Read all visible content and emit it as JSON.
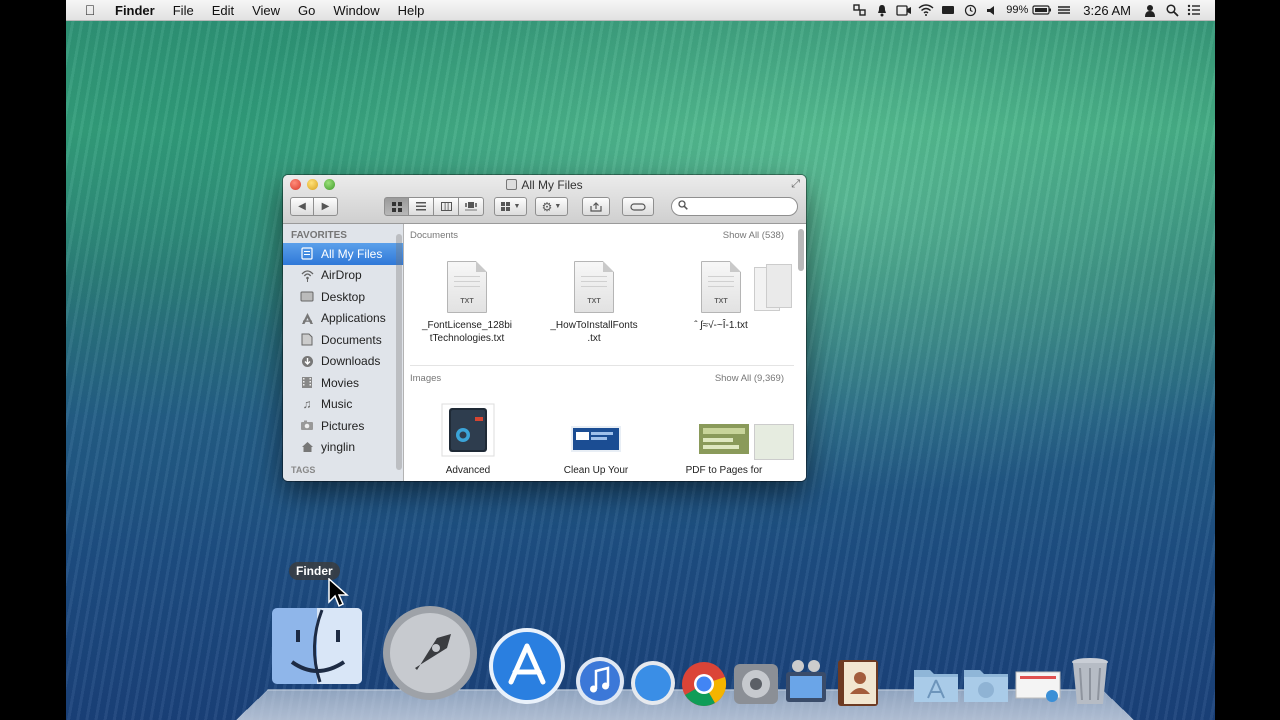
{
  "menubar": {
    "app_name": "Finder",
    "menus": [
      "File",
      "Edit",
      "View",
      "Go",
      "Window",
      "Help"
    ],
    "battery": "99%",
    "clock": "3:26 AM"
  },
  "window": {
    "title": "All My Files",
    "sidebar": {
      "favorites_header": "FAVORITES",
      "items": [
        {
          "label": "All My Files",
          "icon": "all-files-icon",
          "selected": true
        },
        {
          "label": "AirDrop",
          "icon": "airdrop-icon"
        },
        {
          "label": "Desktop",
          "icon": "desktop-icon"
        },
        {
          "label": "Applications",
          "icon": "applications-icon"
        },
        {
          "label": "Documents",
          "icon": "documents-icon"
        },
        {
          "label": "Downloads",
          "icon": "downloads-icon"
        },
        {
          "label": "Movies",
          "icon": "movies-icon"
        },
        {
          "label": "Music",
          "icon": "music-icon"
        },
        {
          "label": "Pictures",
          "icon": "pictures-icon"
        },
        {
          "label": "yinglin",
          "icon": "home-icon"
        }
      ],
      "tags_header": "TAGS"
    },
    "documents": {
      "header": "Documents",
      "show_all": "Show All (538)",
      "files": [
        {
          "name": "_FontLicense_128bitTechnologies.txt",
          "line1": "_FontLicense_128bi",
          "line2": "tTechnologies.txt",
          "badge": "TXT"
        },
        {
          "name": "_HowToInstallFonts.txt",
          "line1": "_HowToInstallFonts",
          "line2": ".txt",
          "badge": "TXT"
        },
        {
          "name": "ʃ≈√-~Î-1.txt",
          "line1": "ˆ ʃ≈√-~Î-1.txt",
          "line2": "",
          "badge": "TXT"
        }
      ]
    },
    "images": {
      "header": "Images",
      "show_all": "Show All (9,369)",
      "files": [
        {
          "line1": "Advanced"
        },
        {
          "line1": "Clean Up Your"
        },
        {
          "line1": "PDF to Pages for"
        }
      ]
    }
  },
  "dock": {
    "tooltip": "Finder",
    "apps": [
      "finder-icon",
      "launchpad-icon",
      "app-store-icon",
      "itunes-icon",
      "safari-icon",
      "chrome-icon",
      "system-preferences-icon",
      "imovie-icon",
      "contacts-icon",
      "applications-folder-icon",
      "downloads-stack-icon",
      "preview-icon",
      "trash-icon"
    ]
  },
  "colors": {
    "selection": "#2f78d8",
    "menubar": "#ececec",
    "desktop_top": "#3aa37d",
    "desktop_bottom": "#1a417a"
  }
}
